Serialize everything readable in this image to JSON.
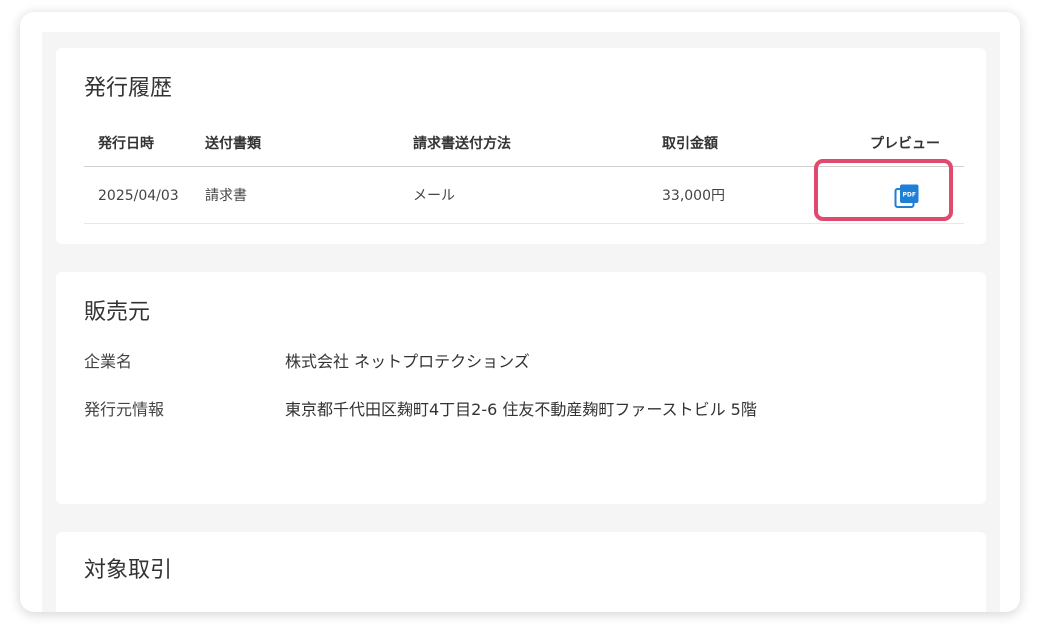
{
  "history": {
    "title": "発行履歴",
    "columns": [
      "発行日時",
      "送付書類",
      "請求書送付方法",
      "取引金額",
      "プレビュー"
    ],
    "rows": [
      {
        "date": "2025/04/03",
        "document": "請求書",
        "method": "メール",
        "amount": "33,000円",
        "preview_icon": "pdf-icon"
      }
    ]
  },
  "seller": {
    "title": "販売元",
    "fields": [
      {
        "label": "企業名",
        "value": "株式会社 ネットプロテクションズ"
      },
      {
        "label": "発行元情報",
        "value": "東京都千代田区麹町4丁目2-6 住友不動産麹町ファーストビル 5階"
      }
    ]
  },
  "target": {
    "title": "対象取引"
  },
  "colors": {
    "accent_blue": "#1e7fd6",
    "highlight": "#e04a6f"
  }
}
